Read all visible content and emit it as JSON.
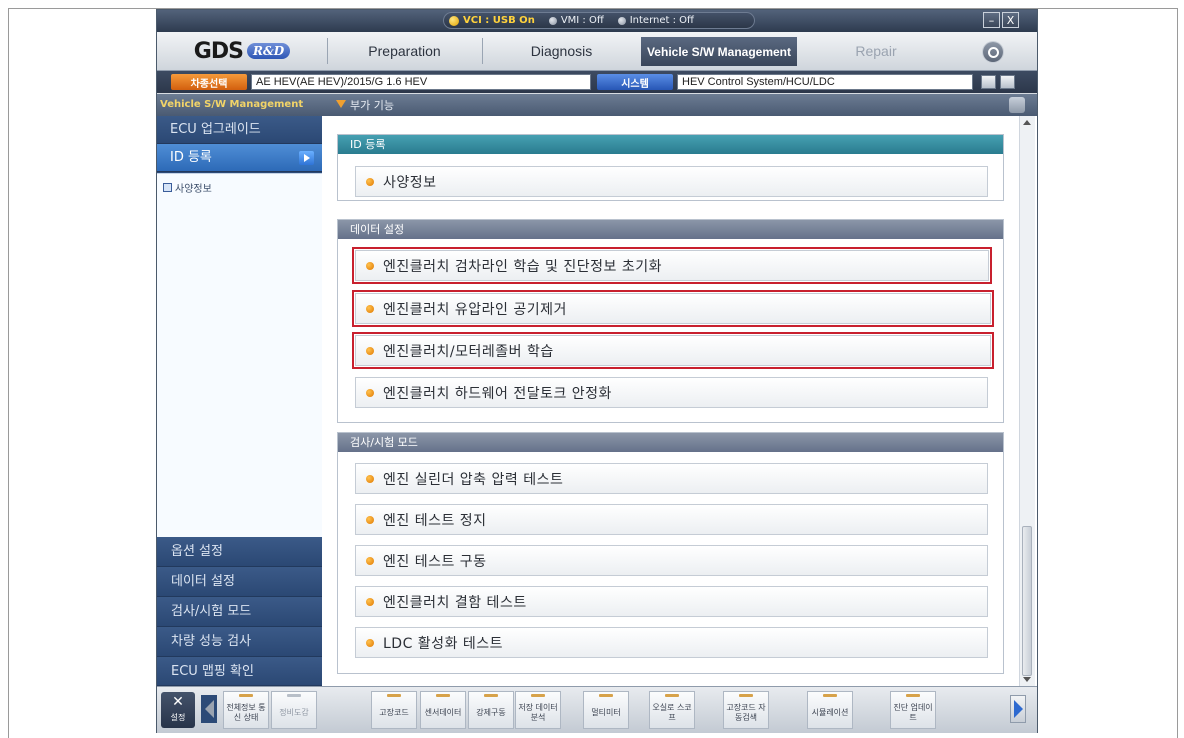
{
  "status": {
    "vci": "VCI : USB On",
    "vmi": "VMI : Off",
    "internet": "Internet : Off",
    "minimize": "–",
    "close": "X"
  },
  "tabs": {
    "logo_gds": "GDS",
    "logo_rd": "R&D",
    "preparation": "Preparation",
    "diagnosis": "Diagnosis",
    "vehicle_sw": "Vehicle S/W Management",
    "repair": "Repair"
  },
  "vehicle": {
    "car_label": "차종선택",
    "car_value": "AE HEV(AE HEV)/2015/G 1.6 HEV",
    "system_label": "시스템",
    "system_value": "HEV Control System/HCU/LDC"
  },
  "sidebar": {
    "header": "Vehicle S/W Management",
    "items": [
      "ECU 업그레이드",
      "ID 등록"
    ],
    "tree_item": "사양정보",
    "bottom_items": [
      "옵션 설정",
      "데이터 설정",
      "검사/시험 모드",
      "차량 성능 검사",
      "ECU 맵핑 확인"
    ]
  },
  "main": {
    "header": "부가 기능",
    "sections": [
      {
        "title": "ID 등록",
        "items": [
          "사양정보"
        ]
      },
      {
        "title": "데이터 설정",
        "items": [
          "엔진클러치 검차라인 학습 및 진단정보 초기화",
          "엔진클러치 유압라인 공기제거",
          "엔진클러치/모터레졸버 학습",
          "엔진클러치 하드웨어 전달토크 안정화"
        ]
      },
      {
        "title": "검사/시험 모드",
        "items": [
          "엔진 실린더 압축 압력 테스트",
          "엔진 테스트 정지",
          "엔진 테스트 구동",
          "엔진클러치 결함 테스트",
          "LDC 활성화 테스트"
        ]
      }
    ]
  },
  "toolbar": {
    "settings": "설정",
    "functions": [
      "전체정보 통신 상태",
      "정비도감",
      "고장코드",
      "센서데이터",
      "강제구동",
      "저장 데이터 분석",
      "멀티미터",
      "오실로 스코프",
      "고장코드 자동검색",
      "시뮬레이션",
      "진단 업데이트"
    ]
  },
  "colors": {
    "highlight_border": "#c8202e",
    "active_tab": "#3a465a",
    "sidebar_active": "#2d6ab7"
  }
}
